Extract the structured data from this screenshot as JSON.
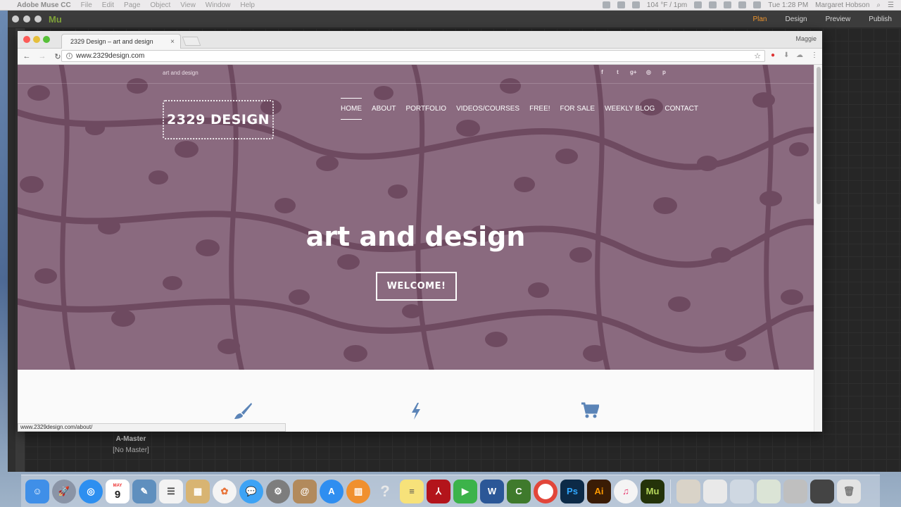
{
  "menubar": {
    "app_name": "Adobe Muse CC",
    "menus": [
      "File",
      "Edit",
      "Page",
      "Object",
      "View",
      "Window",
      "Help"
    ],
    "weather": "104 °F / 1pm",
    "clock": "Tue 1:28 PM",
    "user": "Margaret Hobson"
  },
  "muse": {
    "logo": "Mu",
    "modes": [
      "Plan",
      "Design",
      "Preview",
      "Publish"
    ],
    "active_mode": "Plan",
    "master_name": "A-Master",
    "master_sub": "[No Master]"
  },
  "browser": {
    "tab_title": "2329 Design – art and design",
    "tab_close": "×",
    "profile": "Maggie",
    "url": "www.2329design.com",
    "status_url": "www.2329design.com/about/"
  },
  "site": {
    "tagline": "art and design",
    "social_icons": [
      "facebook-icon",
      "twitter-icon",
      "google-plus-icon",
      "instagram-icon",
      "pinterest-icon"
    ],
    "logo_text": "2329 DESIGN",
    "nav": [
      "HOME",
      "ABOUT",
      "PORTFOLIO",
      "VIDEOS/COURSES",
      "FREE!",
      "FOR SALE",
      "WEEKLY BLOG",
      "CONTACT"
    ],
    "active_nav": "HOME",
    "hero_title": "art and design",
    "hero_button": "WELCOME!",
    "feature_icons": [
      "paintbrush-icon",
      "lightning-icon",
      "shopping-cart-icon"
    ],
    "colors": {
      "hero_bg": "#8a6a7f",
      "pattern": "#6e4a60",
      "feature_icon": "#5b84b7"
    }
  },
  "dock": {
    "apps": [
      "Finder",
      "Launchpad",
      "Safari",
      "Calendar",
      "Preview",
      "Reminders",
      "Photo Booth",
      "Photos",
      "Messages",
      "System Preferences",
      "Contacts",
      "App Store",
      "iBooks",
      "Help",
      "Notes",
      "Acrobat",
      "FaceTime",
      "Word",
      "Camtasia",
      "Chrome",
      "Ps",
      "Ai",
      "iTunes",
      "Mu"
    ],
    "calendar_day": "9",
    "calendar_month": "MAY"
  }
}
